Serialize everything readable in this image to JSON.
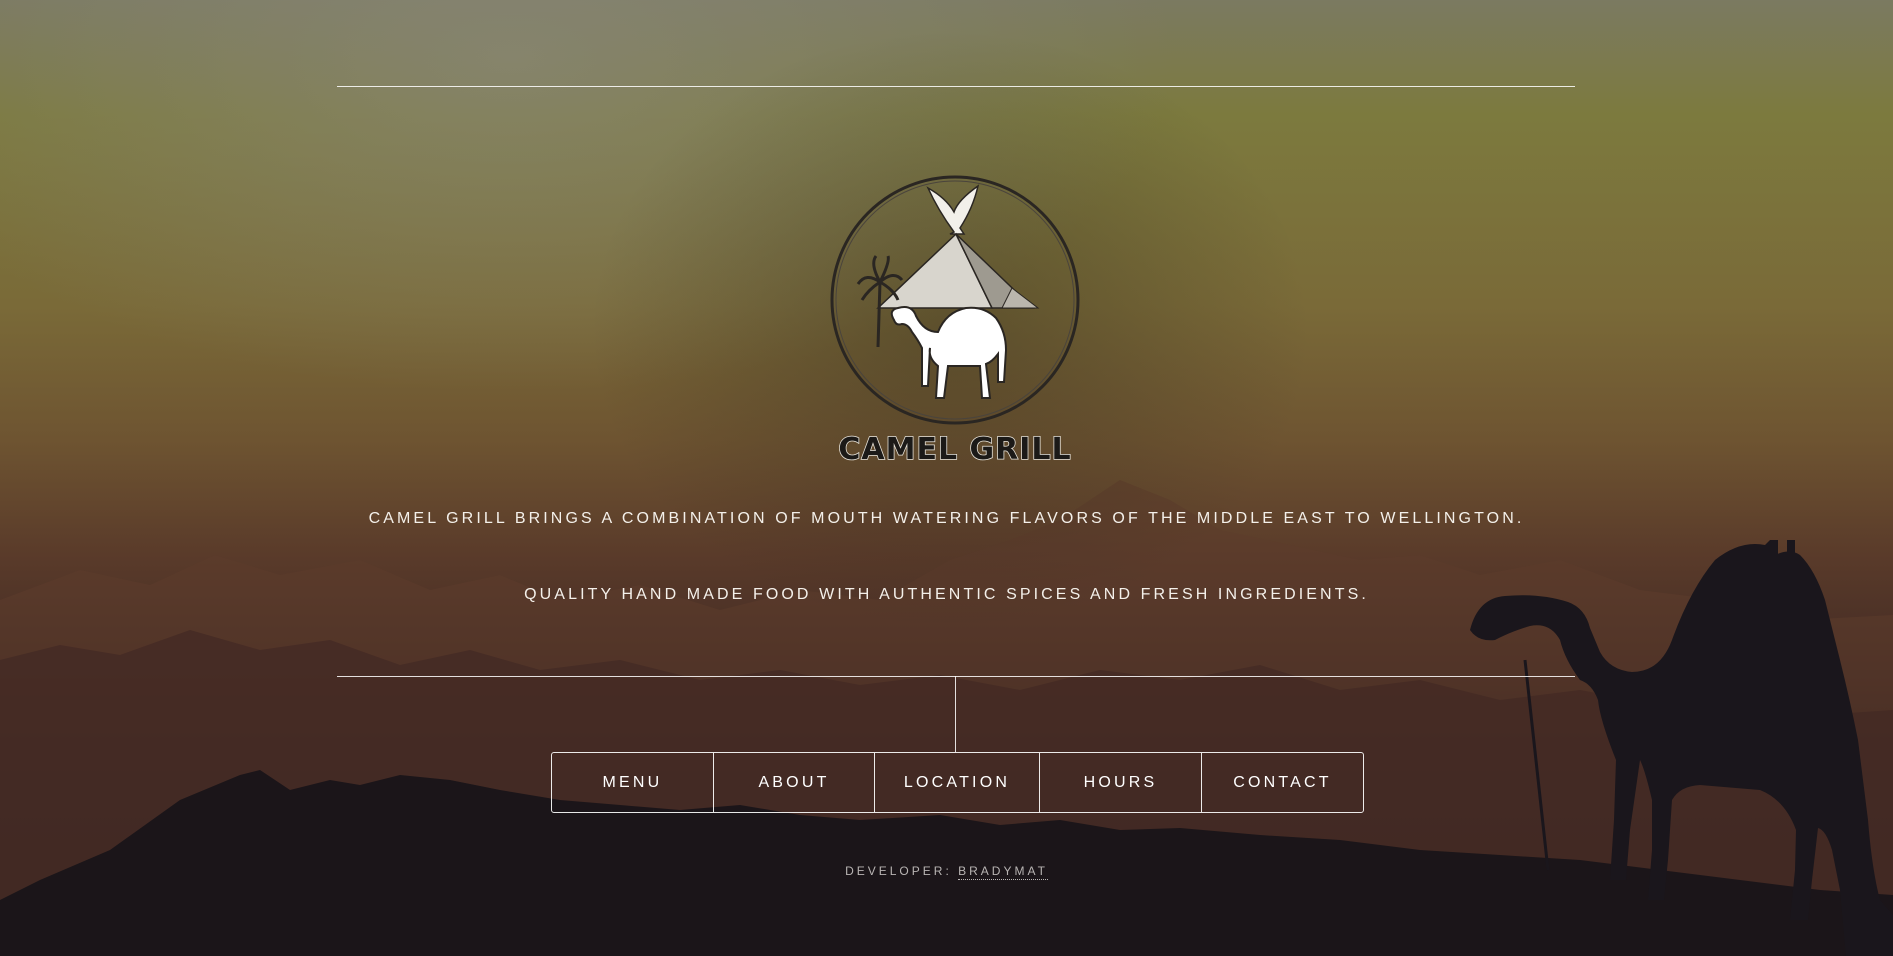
{
  "brand": {
    "logo_icon": "camel-pyramid-eagle-emblem",
    "name": "CAMEL GRILL"
  },
  "taglines": [
    "CAMEL GRILL BRINGS A COMBINATION OF MOUTH WATERING FLAVORS OF THE MIDDLE EAST TO WELLINGTON.",
    "QUALITY HAND MADE FOOD WITH AUTHENTIC SPICES AND FRESH INGREDIENTS."
  ],
  "nav": {
    "items": [
      {
        "label": "MENU"
      },
      {
        "label": "ABOUT"
      },
      {
        "label": "LOCATION"
      },
      {
        "label": "HOURS"
      },
      {
        "label": "CONTACT"
      }
    ]
  },
  "footer": {
    "prefix": "DEVELOPER:",
    "link_label": "BRADYMAT"
  },
  "colors": {
    "sky_top": "#7b7a61",
    "haze": "#7c7a3e",
    "mountains": "#5a3b2a",
    "ground": "#181418",
    "text": "#ffffff"
  }
}
